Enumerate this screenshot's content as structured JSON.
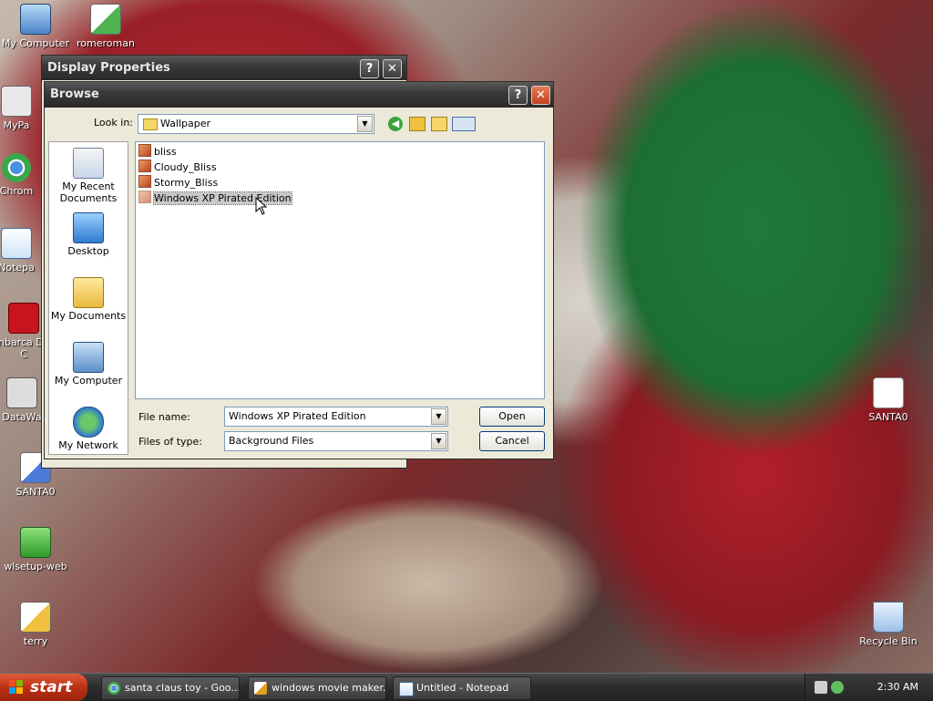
{
  "desktop": {
    "icons": [
      {
        "label": "My Computer",
        "icon": "my-computer-icon"
      },
      {
        "label": "romeroman",
        "icon": "paint-file-icon"
      },
      {
        "label": "MyPa",
        "icon": "shortcut-icon"
      },
      {
        "label": "Chrom",
        "icon": "chrome-icon"
      },
      {
        "label": "Notepa",
        "icon": "notepad-icon"
      },
      {
        "label": "Embarca Dev-C",
        "icon": "devcpp-icon"
      },
      {
        "label": "DataWa",
        "icon": "shortcut-icon"
      },
      {
        "label": "SANTA0",
        "icon": "paint-file-icon"
      },
      {
        "label": "wlsetup-web",
        "icon": "installer-icon"
      },
      {
        "label": "terry",
        "icon": "paint-file-icon"
      },
      {
        "label": "SANTA0",
        "icon": "document-icon"
      },
      {
        "label": "Recycle Bin",
        "icon": "recycle-bin-icon"
      }
    ]
  },
  "display_properties": {
    "title": "Display Properties",
    "help": "?",
    "close": "✕"
  },
  "browse": {
    "title": "Browse",
    "help": "?",
    "close": "✕",
    "look_in_label": "Look in:",
    "look_in_value": "Wallpaper",
    "places": [
      {
        "label": "My Recent Documents",
        "icon": "recent-documents-icon"
      },
      {
        "label": "Desktop",
        "icon": "desktop-icon"
      },
      {
        "label": "My Documents",
        "icon": "my-documents-icon"
      },
      {
        "label": "My Computer",
        "icon": "my-computer-icon"
      },
      {
        "label": "My Network",
        "icon": "my-network-icon"
      }
    ],
    "files": [
      {
        "name": "bliss",
        "selected": false
      },
      {
        "name": "Cloudy_Bliss",
        "selected": false
      },
      {
        "name": "Stormy_Bliss",
        "selected": false
      },
      {
        "name": "Windows XP Pirated Edition",
        "selected": true
      }
    ],
    "file_name_label": "File name:",
    "file_name_value": "Windows XP Pirated Edition",
    "file_type_label": "Files of type:",
    "file_type_value": "Background Files",
    "open_button": "Open",
    "cancel_button": "Cancel"
  },
  "taskbar": {
    "start_label": "start",
    "tasks": [
      {
        "label": "santa claus toy - Goo...",
        "icon": "chrome-icon"
      },
      {
        "label": "windows movie maker...",
        "icon": "paint-file-icon"
      },
      {
        "label": "Untitled - Notepad",
        "icon": "notepad-icon"
      }
    ],
    "clock": "2:30 AM"
  }
}
